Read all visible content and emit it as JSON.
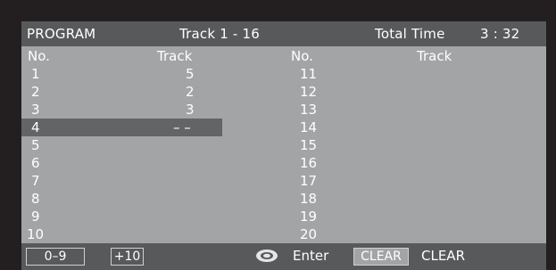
{
  "header": {
    "title": "PROGRAM",
    "track_range": "Track 1 - 16",
    "total_time_label": "Total Time",
    "total_time_value": "3 : 32"
  },
  "columns": {
    "no_left": "No.",
    "track_left": "Track",
    "no_right": "No.",
    "track_right": "Track"
  },
  "left_rows": [
    {
      "no": "1",
      "track": "5"
    },
    {
      "no": "2",
      "track": "2"
    },
    {
      "no": "3",
      "track": "3"
    },
    {
      "no": "4",
      "track": "– –"
    },
    {
      "no": "5",
      "track": ""
    },
    {
      "no": "6",
      "track": ""
    },
    {
      "no": "7",
      "track": ""
    },
    {
      "no": "8",
      "track": ""
    },
    {
      "no": "9",
      "track": ""
    },
    {
      "no": "10",
      "track": ""
    }
  ],
  "right_rows": [
    {
      "no": "11"
    },
    {
      "no": "12"
    },
    {
      "no": "13"
    },
    {
      "no": "14"
    },
    {
      "no": "15"
    },
    {
      "no": "16"
    },
    {
      "no": "17"
    },
    {
      "no": "18"
    },
    {
      "no": "19"
    },
    {
      "no": "20"
    }
  ],
  "highlighted_row": 4,
  "footer": {
    "digits_key": "0–9",
    "plus10_key": "+10",
    "enter_icon": "enter-button-icon",
    "enter_label": "Enter",
    "clear_key": "CLEAR",
    "clear_label": "CLEAR"
  },
  "colors": {
    "background": "#231f20",
    "panel": "#a3a4a6",
    "bar": "#58595b",
    "highlight": "#636466"
  }
}
